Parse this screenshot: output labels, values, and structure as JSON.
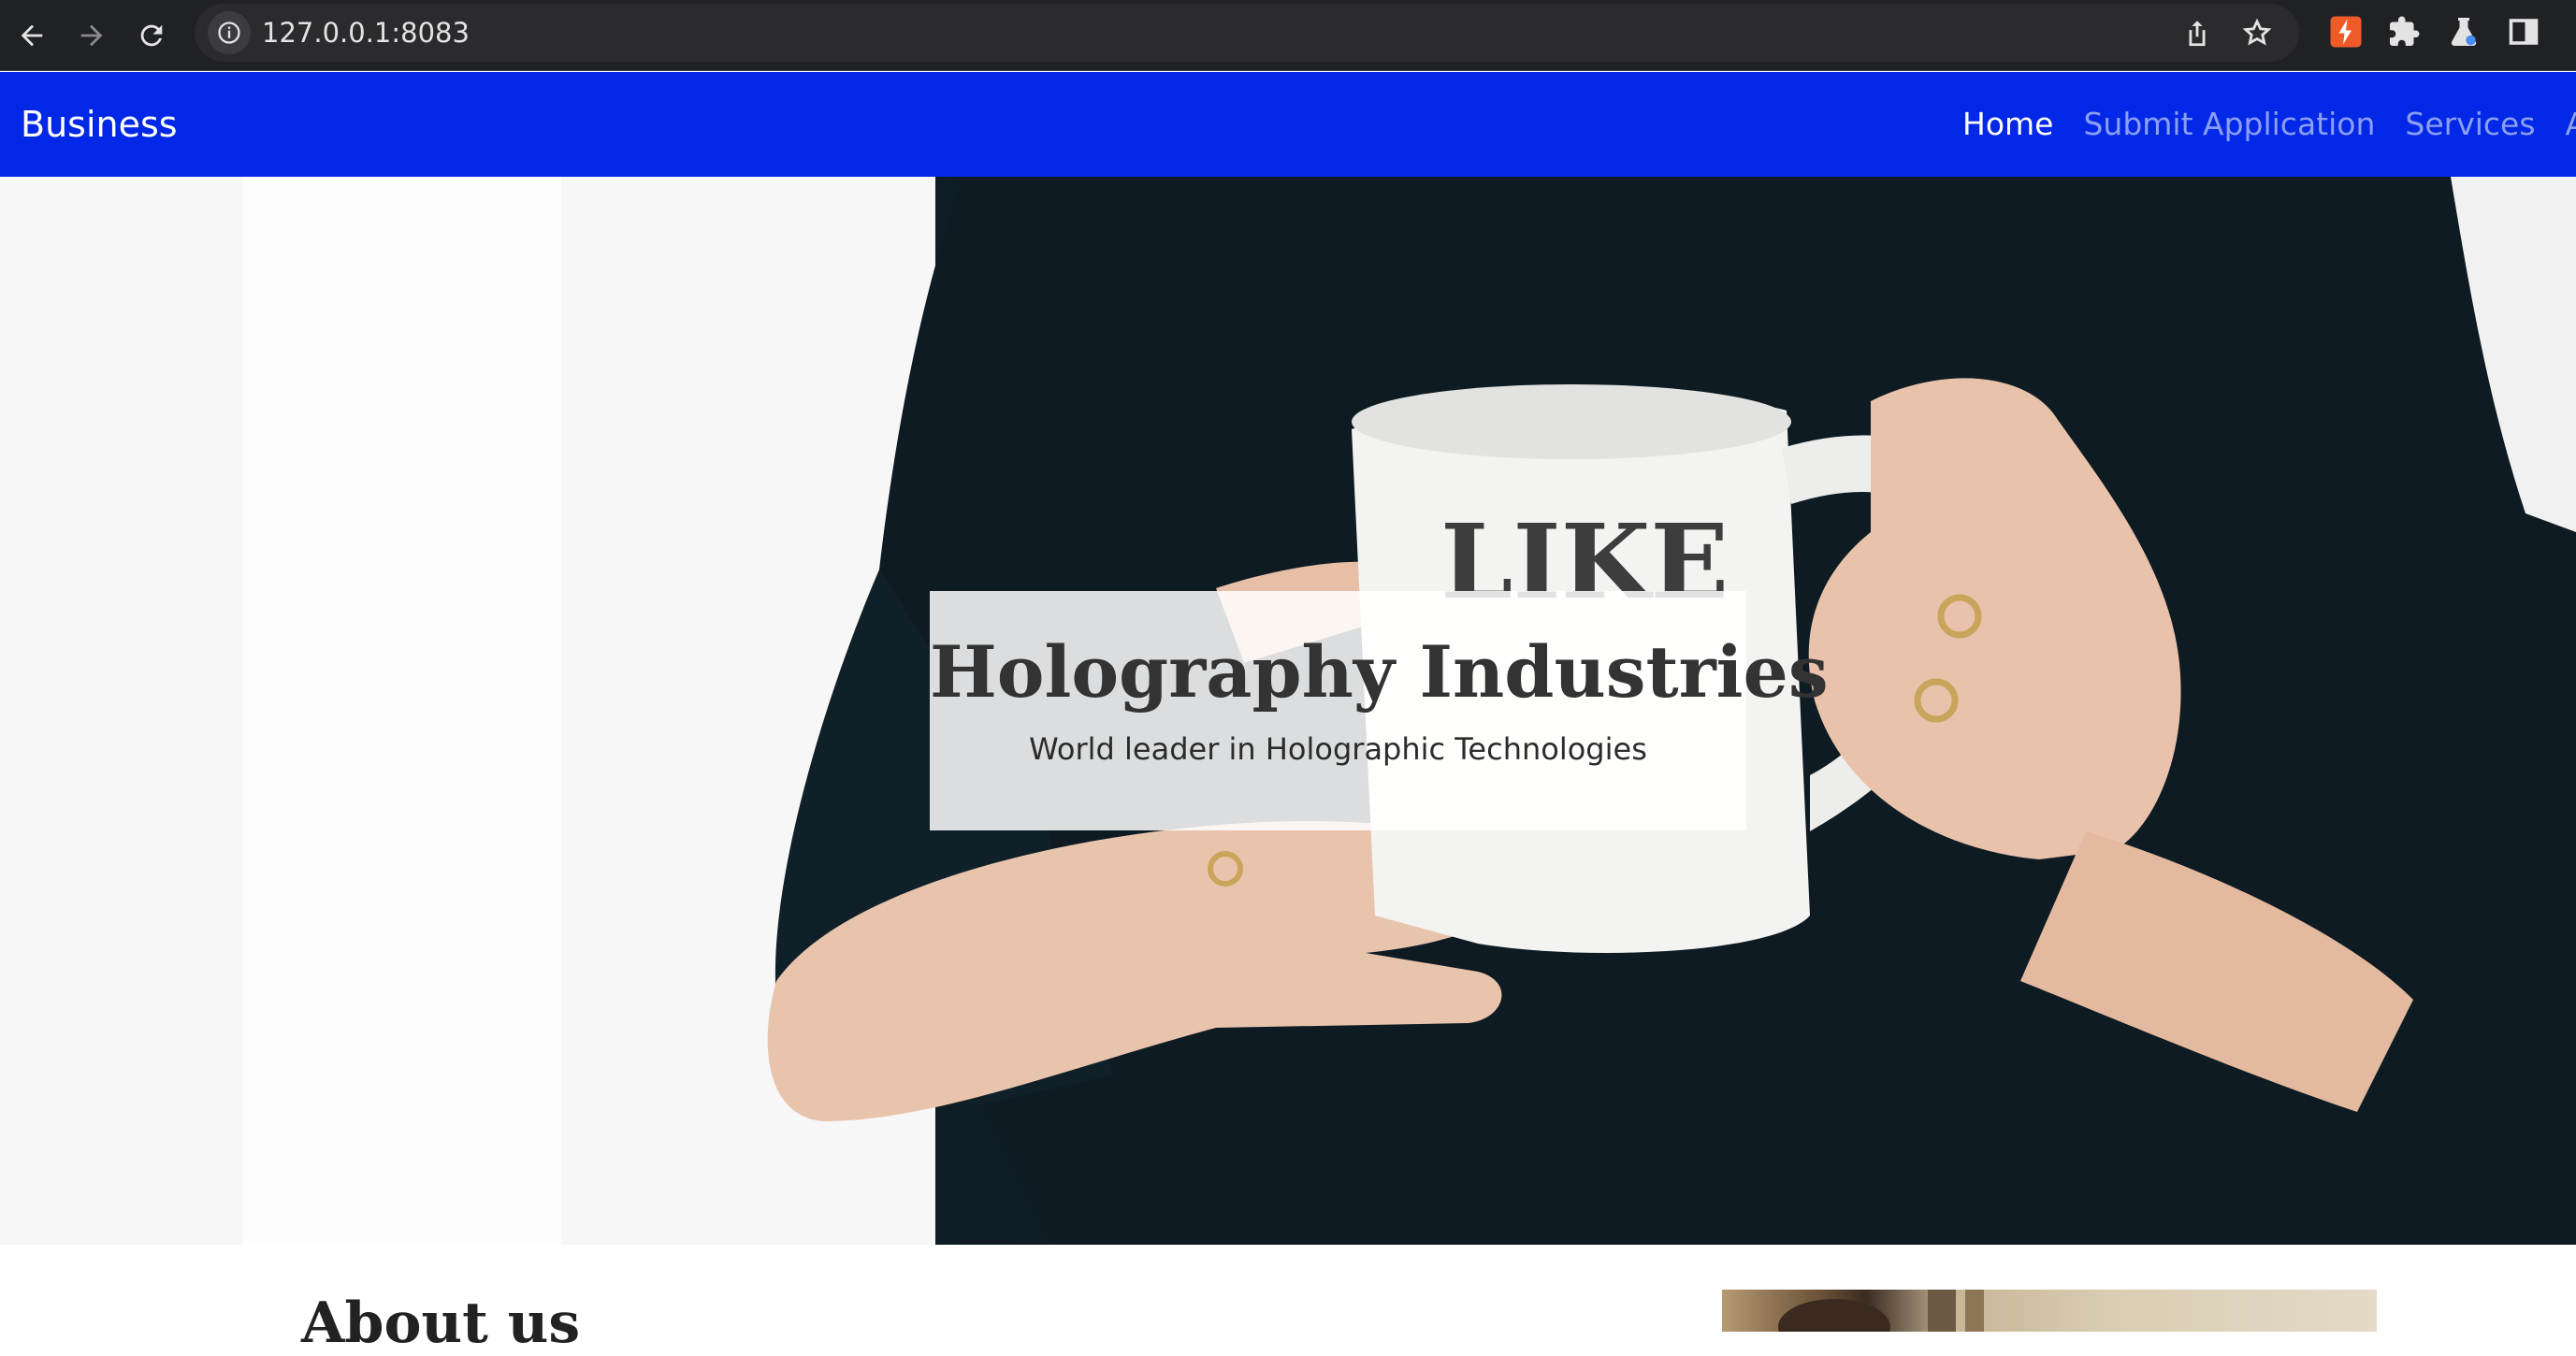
{
  "browser": {
    "url": "127.0.0.1:8083",
    "icons": [
      "back-arrow-icon",
      "forward-arrow-icon",
      "reload-icon",
      "site-info-icon",
      "share-icon",
      "bookmark-star-icon",
      "extension-bolt-icon",
      "puzzle-extensions-icon",
      "labs-flask-icon",
      "side-panel-icon"
    ]
  },
  "navbar": {
    "brand": "Business",
    "links": [
      {
        "label": "Home",
        "active": true
      },
      {
        "label": "Submit Application",
        "active": false
      },
      {
        "label": "Services",
        "active": false
      },
      {
        "label": "Al",
        "active": false
      }
    ],
    "background": "#0028e6"
  },
  "hero": {
    "title": "Holography Industries",
    "subtitle": "World leader in Holographic Technologies",
    "image_subject": "person-holding-mug-photo"
  },
  "about": {
    "title": "About us"
  }
}
